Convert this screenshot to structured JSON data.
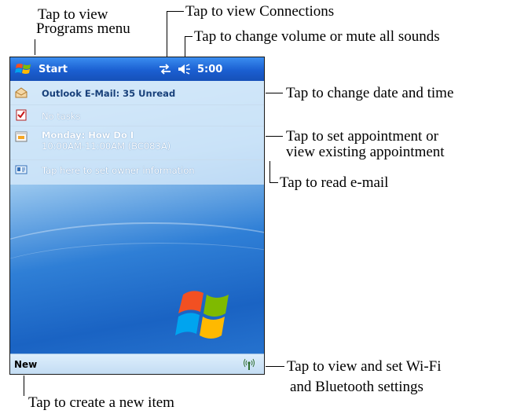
{
  "callouts": {
    "programs_line1": "Tap to view",
    "programs_line2": "Programs menu",
    "connections": "Tap to view Connections",
    "volume": "Tap to change volume or mute all sounds",
    "datetime": "Tap to change date and time",
    "appointment_line1": "Tap to set appointment or",
    "appointment_line2": "view existing appointment",
    "email": "Tap to read e-mail",
    "wifi_line1": "Tap to view and set Wi-Fi",
    "wifi_line2": "and Bluetooth settings",
    "new_item": "Tap to create a new item"
  },
  "device": {
    "start_label": "Start",
    "clock": "5:00",
    "icons": {
      "start": "windows-flag-icon",
      "connections": "connections-icon",
      "volume": "speaker-icon",
      "email": "envelope-icon",
      "tasks": "tasks-icon",
      "calendar": "calendar-icon",
      "owner": "owner-card-icon",
      "wifi": "wireless-icon"
    },
    "today": {
      "email_text": "Outlook E-Mail: 35 Unread",
      "tasks_text": "No tasks",
      "appointment_title": "Monday: How Do I",
      "appointment_detail": "10:00AM-11:00AM (BC083A)",
      "owner_text": "Tap here to set owner information"
    },
    "bottom": {
      "new_label": "New"
    },
    "colors": {
      "title_bar": "#1b5fd1",
      "desktop": "#1a63c3",
      "today_panel": "#d6e9fa"
    }
  }
}
